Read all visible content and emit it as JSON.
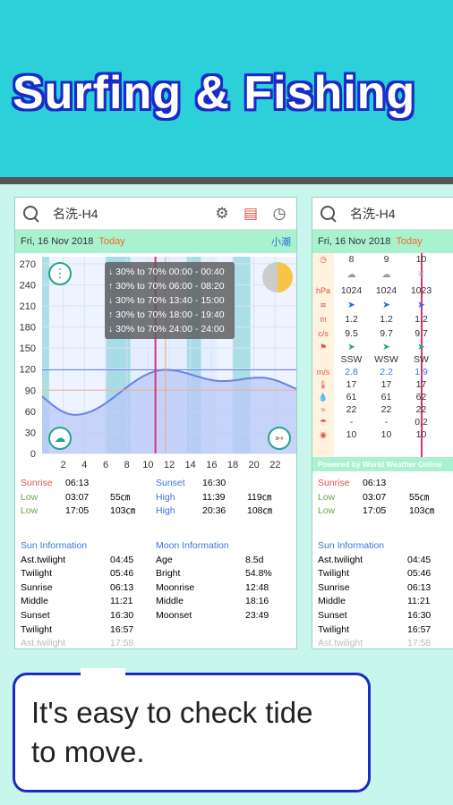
{
  "banner": {
    "title": "Surfing & Fishing"
  },
  "card1": {
    "location": "名洗-H4",
    "date": "Fri, 16 Nov 2018",
    "today": "Today",
    "tide_type": "小潮",
    "y_ticks": [
      "270",
      "240",
      "210",
      "180",
      "150",
      "120",
      "90",
      "60",
      "30",
      "0"
    ],
    "x_ticks": [
      "2",
      "4",
      "6",
      "8",
      "10",
      "12",
      "14",
      "16",
      "18",
      "20",
      "22"
    ],
    "fishing_windows": [
      "↓ 30% to 70% 00:00 - 00:40",
      "↑ 30% to 70% 06:00 - 08:20",
      "↓ 30% to 70% 13:40 - 15:00",
      "↑ 30% to 70% 18:00 - 19:40",
      "↓ 30% to 70% 24:00 - 24:00"
    ],
    "tides_left": [
      {
        "label": "Sunrise",
        "time": "06:13",
        "value": "",
        "kind": "sunrise"
      },
      {
        "label": "Low",
        "time": "03:07",
        "value": "55㎝",
        "kind": "low"
      },
      {
        "label": "Low",
        "time": "17:05",
        "value": "103㎝",
        "kind": "low"
      }
    ],
    "tides_right": [
      {
        "label": "Sunset",
        "time": "16:30",
        "value": "",
        "kind": "high"
      },
      {
        "label": "High",
        "time": "11:39",
        "value": "119㎝",
        "kind": "high"
      },
      {
        "label": "High",
        "time": "20:36",
        "value": "108㎝",
        "kind": "high"
      }
    ],
    "sun_info": {
      "title": "Sun Information",
      "rows": [
        {
          "label": "Ast.twilight",
          "value": "04:45"
        },
        {
          "label": "Twilight",
          "value": "05:46"
        },
        {
          "label": "Sunrise",
          "value": "06:13"
        },
        {
          "label": "Middle",
          "value": "11:21"
        },
        {
          "label": "Sunset",
          "value": "16:30"
        },
        {
          "label": "Twilight",
          "value": "16:57"
        },
        {
          "label": "Ast.twilight",
          "value": "17:58"
        }
      ]
    },
    "moon_info": {
      "title": "Moon Information",
      "rows": [
        {
          "label": "Age",
          "value": "8.5d"
        },
        {
          "label": "Bright",
          "value": "54.8%"
        },
        {
          "label": "Moonrise",
          "value": "12:48"
        },
        {
          "label": "Middle",
          "value": "18:16"
        },
        {
          "label": "Moonset",
          "value": "23:49"
        }
      ]
    }
  },
  "card2": {
    "location": "名洗-H4",
    "date": "Fri, 16 Nov 2018",
    "today": "Today",
    "hours": [
      "8",
      "9",
      "10"
    ],
    "unit_hpa": "hPa",
    "pressure": [
      "1024",
      "1024",
      "1023"
    ],
    "unit_m": "m",
    "wave": [
      "1.2",
      "1.2",
      "1.2"
    ],
    "unit_cs": "c/s",
    "period": [
      "9.5",
      "9.7",
      "9.7"
    ],
    "wind_dir": [
      "SSW",
      "WSW",
      "SW"
    ],
    "unit_ms": "m/s",
    "wind_speed": [
      "2.8",
      "2.2",
      "1.9"
    ],
    "temp": [
      "17",
      "17",
      "17"
    ],
    "humidity": [
      "61",
      "61",
      "62"
    ],
    "sea_temp": [
      "22",
      "22",
      "22"
    ],
    "precip": [
      "-",
      "-",
      "0.2"
    ],
    "visibility": [
      "10",
      "10",
      "10"
    ],
    "powered": "Powered by World Weather Online",
    "tides_left": [
      {
        "label": "Sunrise",
        "time": "06:13",
        "kind": "sunrise"
      },
      {
        "label": "Low",
        "time": "03:07",
        "kind": "low"
      },
      {
        "label": "Low",
        "time": "17:05",
        "kind": "low"
      }
    ],
    "tide_values": [
      "",
      "55㎝",
      "103㎝"
    ],
    "sun_info": {
      "title": "Sun Information",
      "rows": [
        {
          "label": "Ast.twilight",
          "value": "04:45"
        },
        {
          "label": "Twilight",
          "value": "05:46"
        },
        {
          "label": "Sunrise",
          "value": "06:13"
        },
        {
          "label": "Middle",
          "value": "11:21"
        },
        {
          "label": "Sunset",
          "value": "16:30"
        },
        {
          "label": "Twilight",
          "value": "16:57"
        },
        {
          "label": "Ast.twilight",
          "value": "17:58"
        }
      ]
    }
  },
  "callout": {
    "line1": "It's easy to check tide",
    "line2": "to move."
  }
}
